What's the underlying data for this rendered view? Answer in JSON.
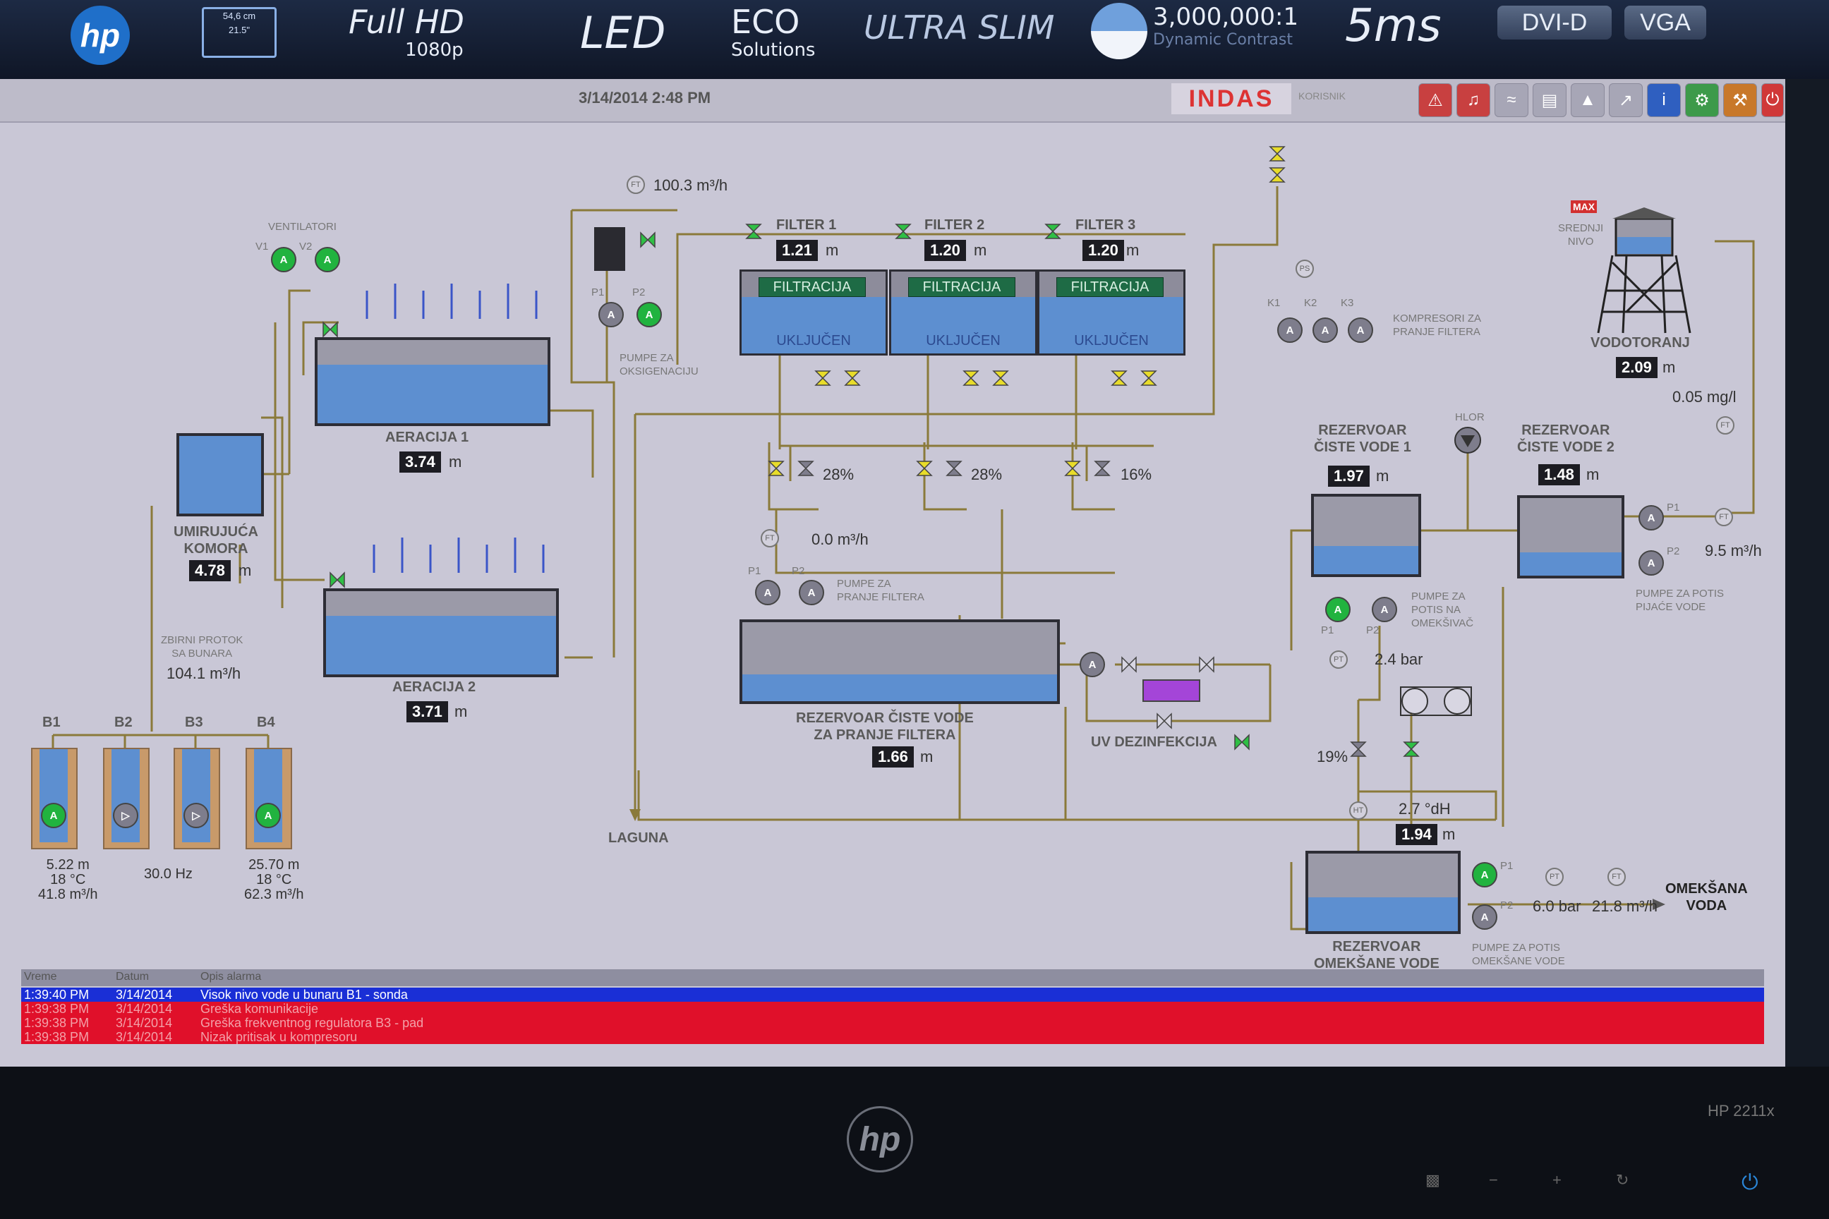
{
  "bezel": {
    "brand": "hp",
    "screen_size": "54,6 cm\n21.5\"",
    "full_hd": "Full HD",
    "res": "1080p",
    "led": "LED",
    "eco": "ECO",
    "eco_sub": "Solutions",
    "ultra": "ULTRA SLIM",
    "contrast": "3,000,000:1",
    "contrast_sub": "Dynamic Contrast",
    "response": "5ms",
    "btn_dvi": "DVI-D",
    "btn_vga": "VGA",
    "model": "HP 2211x",
    "bottom_brand": "hp"
  },
  "header": {
    "datetime": "3/14/2014 2:48 PM",
    "logo": "INDAS",
    "user_label": "KORISNIK"
  },
  "toolbar_icons": [
    "alarm-bell-icon",
    "sound-icon",
    "trend-icon",
    "report-icon",
    "chart-icon",
    "graph-icon",
    "info-icon",
    "settings-icon",
    "tools-icon",
    "power-icon"
  ],
  "top": {
    "flow_in": "100.3 m³/h",
    "ventilatori": "VENTILATORI",
    "v1": "V1",
    "v2": "V2",
    "p1": "P1",
    "p2": "P2",
    "pumps_oxy": "PUMPE ZA\nOKSIGENACIJU"
  },
  "filters": [
    {
      "name": "FILTER 1",
      "level": "1.21",
      "unit": "m",
      "state": "FILTRACIJA",
      "status": "UKLJUČEN",
      "valve_pct": "28%"
    },
    {
      "name": "FILTER 2",
      "level": "1.20",
      "unit": "m",
      "state": "FILTRACIJA",
      "status": "UKLJUČEN",
      "valve_pct": "28%"
    },
    {
      "name": "FILTER 3",
      "level": "1.20",
      "unit": "m",
      "state": "FILTRACIJA",
      "status": "UKLJUČEN",
      "valve_pct": "16%"
    }
  ],
  "compressors": {
    "k1": "K1",
    "k2": "K2",
    "k3": "K3",
    "label": "KOMPRESORI ZA\nPRANJE FILTERA",
    "ps": "PS"
  },
  "tower": {
    "max": "MAX",
    "srednji": "SREDNJI\nNIVO",
    "name": "VODOTORANJ",
    "level": "2.09",
    "unit": "m",
    "chlor": "0.05 mg/l",
    "ft": "FT"
  },
  "aeration": [
    {
      "name": "AERACIJA 1",
      "level": "3.74",
      "unit": "m"
    },
    {
      "name": "AERACIJA 2",
      "level": "3.71",
      "unit": "m"
    }
  ],
  "komora": {
    "name": "UMIRUJUĆA\nKOMORA",
    "level": "4.78",
    "unit": "m"
  },
  "wells": {
    "b1": "B1",
    "b2": "B2",
    "b3": "B3",
    "b4": "B4",
    "total_label": "ZBIRNI PROTOK\nSA BUNARA",
    "total": "104.1 m³/h",
    "b1_data": "5.22 m\n18 °C\n41.8 m³/h",
    "b2_data": "30.0 Hz",
    "b4_data": "25.70 m\n18 °C\n62.3 m³/h"
  },
  "wash": {
    "ft": "FT",
    "flow": "0.0 m³/h",
    "p1": "P1",
    "p2": "P2",
    "pumps": "PUMPE ZA\nPRANJE FILTERA",
    "tank": "REZERVOAR ČISTE VODE\nZA PRANJE FILTERA",
    "level": "1.66",
    "unit": "m"
  },
  "laguna": "LAGUNA",
  "uv": "UV DEZINFEKCIJA",
  "clean1": {
    "name": "REZERVOAR\nČISTE VODE 1",
    "level": "1.97",
    "unit": "m",
    "p1": "P1",
    "p2": "P2",
    "pumps": "PUMPE ZA\nPOTIS NA\nOMEKŠIVAČ",
    "pt": "PT",
    "pressure": "2.4 bar",
    "valve_pct": "19%"
  },
  "hlor": "HLOR",
  "clean2": {
    "name": "REZERVOAR\nČISTE VODE 2",
    "level": "1.48",
    "unit": "m",
    "p1": "P1",
    "p2": "P2",
    "pumps": "PUMPE ZA POTIS\nPIJAĆE VODE",
    "ft": "FT",
    "flow": "9.5 m³/h"
  },
  "soft": {
    "ht": "HT",
    "hardness": "2.7 °dH",
    "level": "1.94",
    "unit": "m",
    "name": "REZERVOAR\nOMEKŠANE VODE",
    "p1": "P1",
    "p2": "P2",
    "pumps": "PUMPE ZA POTIS\nOMEKŠANE VODE",
    "pt": "PT",
    "ft": "FT",
    "pressure": "6.0 bar",
    "flow": "21.8 m³/h",
    "out": "OMEKŠANA\nVODA"
  },
  "alarms": {
    "columns": [
      "Vreme",
      "Datum",
      "Opis alarma"
    ],
    "rows": [
      {
        "time": "1:39:40 PM",
        "date": "3/14/2014",
        "text": "Visok nivo vode u bunaru B1 - sonda",
        "color": "#1a2fd6"
      },
      {
        "time": "1:39:38 PM",
        "date": "3/14/2014",
        "text": "Greška komunikacije",
        "color": "#e0102a"
      },
      {
        "time": "1:39:38 PM",
        "date": "3/14/2014",
        "text": "Greška frekventnog regulatora B3 - pad",
        "color": "#e0102a"
      },
      {
        "time": "1:39:38 PM",
        "date": "3/14/2014",
        "text": "Nizak pritisak u kompresoru",
        "color": "#e0102a"
      }
    ]
  },
  "colors": {
    "water": "#5d8fd0",
    "pipe": "#8a7a3a",
    "valve_on": "#2fbf45",
    "valve_warn": "#e8dc2a",
    "alarm_blue": "#1a2fd6",
    "alarm_red": "#e0102a"
  }
}
